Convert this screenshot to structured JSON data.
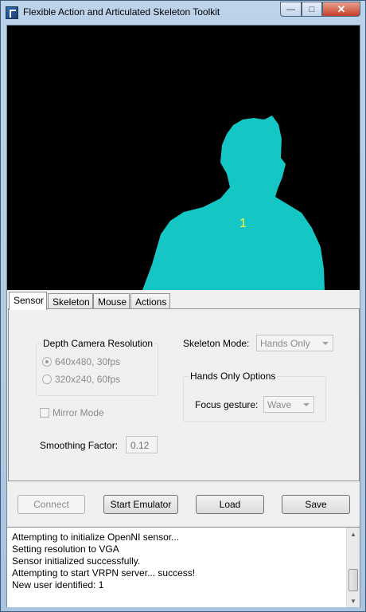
{
  "window": {
    "title": "Flexible Action and Articulated Skeleton Toolkit",
    "minimize_glyph": "—",
    "maximize_glyph": "□",
    "close_glyph": "✕"
  },
  "depth_view": {
    "user_label": "1",
    "user_color": "#14c7c4",
    "label_color": "#ffff33"
  },
  "tabs": [
    {
      "label": "Sensor",
      "active": true
    },
    {
      "label": "Skeleton",
      "active": false
    },
    {
      "label": "Mouse",
      "active": false
    },
    {
      "label": "Actions",
      "active": false
    }
  ],
  "sensor": {
    "depth_group_title": "Depth Camera Resolution",
    "resolution_options": [
      "640x480, 30fps",
      "320x240, 60fps"
    ],
    "selected_resolution": "640x480, 30fps",
    "skeleton_mode_label": "Skeleton Mode:",
    "skeleton_mode_value": "Hands Only",
    "hands_group_title": "Hands Only Options",
    "focus_gesture_label": "Focus gesture:",
    "focus_gesture_value": "Wave",
    "mirror_mode_label": "Mirror Mode",
    "mirror_mode_checked": false,
    "smoothing_label": "Smoothing Factor:",
    "smoothing_value": "0.12"
  },
  "buttons": {
    "connect": "Connect",
    "start_emulator": "Start Emulator",
    "load": "Load",
    "save": "Save"
  },
  "log": {
    "lines": [
      "Attempting to initialize OpenNI sensor...",
      "Setting resolution to VGA",
      "Sensor initialized successfully.",
      "Attempting to start VRPN server... success!",
      "New user identified: 1"
    ]
  }
}
